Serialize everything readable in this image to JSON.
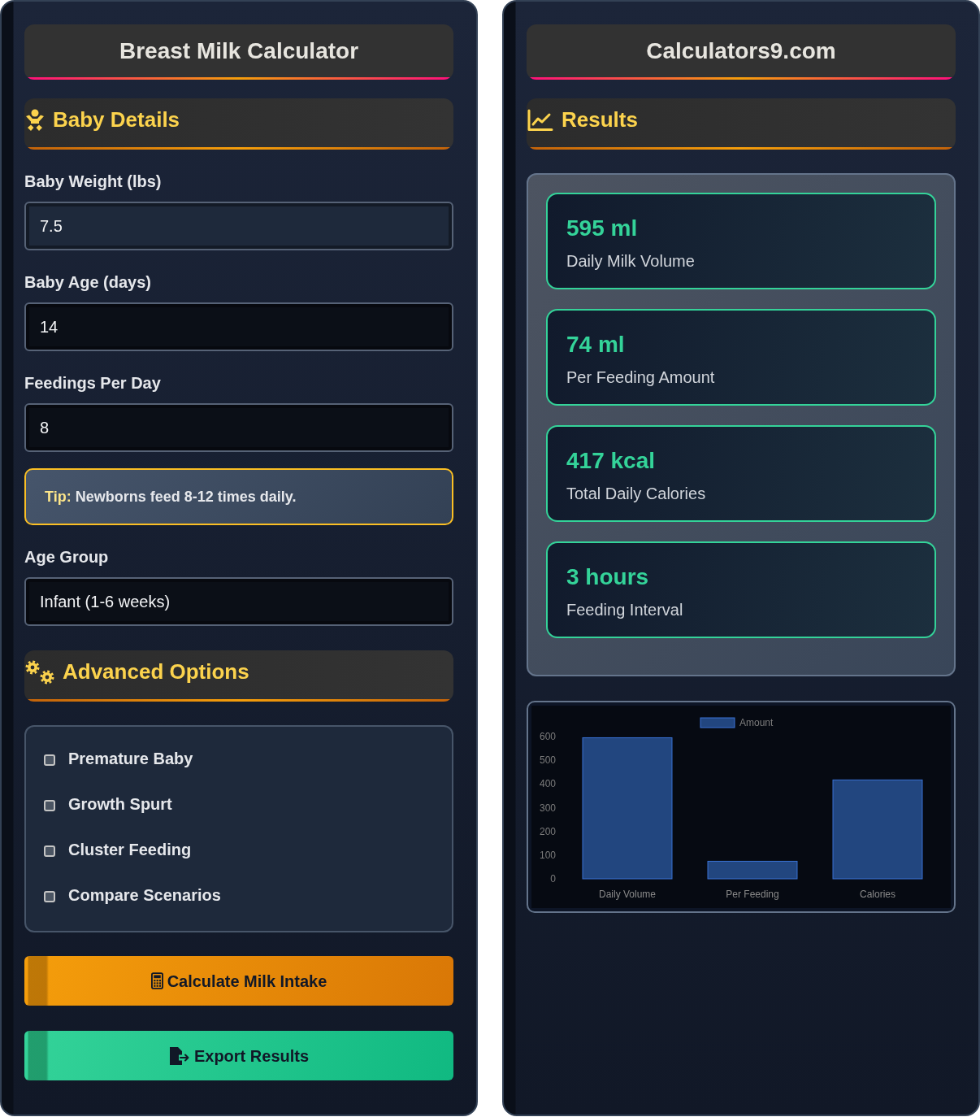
{
  "left_panel": {
    "title": "Breast Milk Calculator",
    "baby_details": {
      "heading": "Baby Details",
      "fields": [
        {
          "label": "Baby Weight (lbs)",
          "value": "7.5",
          "focused": true
        },
        {
          "label": "Baby Age (days)",
          "value": "14",
          "focused": false
        },
        {
          "label": "Feedings Per Day",
          "value": "8",
          "focused": false
        }
      ],
      "tip": "**Tip:** Newborns feed 8-12 times daily.",
      "age_group": {
        "label": "Age Group",
        "value": "Infant (1-6 weeks)"
      }
    },
    "advanced_options": {
      "heading": "Advanced Options",
      "options": [
        {
          "label": "Premature Baby",
          "checked": false
        },
        {
          "label": "Growth Spurt",
          "checked": false
        },
        {
          "label": "Cluster Feeding",
          "checked": false
        },
        {
          "label": "Compare Scenarios",
          "checked": false
        }
      ]
    },
    "buttons": [
      {
        "kind": "calculate",
        "label": "Calculate Milk Intake"
      },
      {
        "kind": "export",
        "label": "Export Results"
      }
    ]
  },
  "right_panel": {
    "title": "Calculators9.com",
    "results": {
      "heading": "Results",
      "cards": [
        {
          "value": "595 ml",
          "label": "Daily Milk Volume"
        },
        {
          "value": "74 ml",
          "label": "Per Feeding Amount"
        },
        {
          "value": "417 kcal",
          "label": "Total Daily Calories"
        },
        {
          "value": "3 hours",
          "label": "Feeding Interval"
        }
      ]
    },
    "chart": {
      "chart_data": {
        "type": "bar",
        "categories": [
          "Daily Volume",
          "Per Feeding",
          "Calories"
        ],
        "series": [
          {
            "name": "Amount",
            "color": "#22467f",
            "values": [
              595,
              74,
              417
            ]
          }
        ],
        "ylim": [
          0,
          600
        ],
        "yticks": [
          0,
          100,
          200,
          300,
          400,
          500,
          600
        ]
      }
    }
  }
}
